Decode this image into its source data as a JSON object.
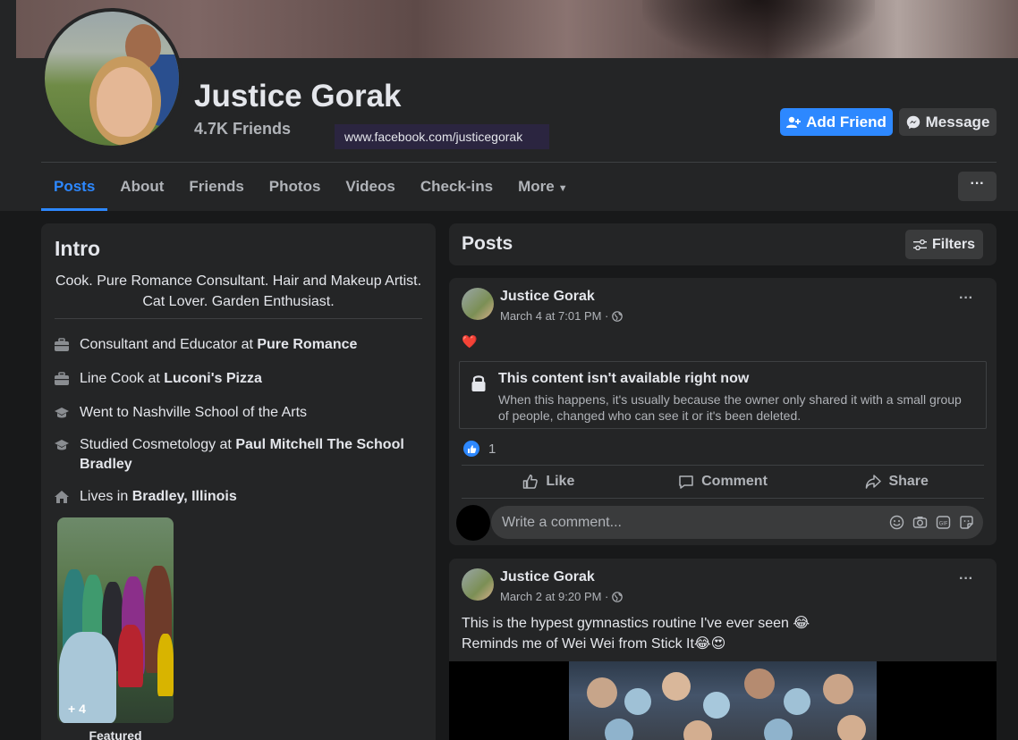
{
  "profile": {
    "name": "Justice Gorak",
    "friends": "4.7K Friends",
    "url": "www.facebook.com/justicegorak",
    "add_friend_label": "Add Friend",
    "message_label": "Message"
  },
  "tabs": [
    {
      "label": "Posts",
      "active": true
    },
    {
      "label": "About"
    },
    {
      "label": "Friends"
    },
    {
      "label": "Photos"
    },
    {
      "label": "Videos"
    },
    {
      "label": "Check-ins"
    },
    {
      "label": "More"
    }
  ],
  "more_menu_label": "···",
  "intro": {
    "title": "Intro",
    "bio": "Cook. Pure Romance Consultant. Hair and Makeup Artist. Cat Lover. Garden Enthusiast.",
    "items": [
      {
        "icon": "briefcase-icon",
        "prefix": "Consultant and Educator at ",
        "bold": "Pure Romance"
      },
      {
        "icon": "briefcase-icon",
        "prefix": "Line Cook at ",
        "bold": "Luconi's Pizza"
      },
      {
        "icon": "graduation-cap-icon",
        "prefix": "Went to Nashville School of the Arts",
        "bold": ""
      },
      {
        "icon": "graduation-cap-icon",
        "prefix": "Studied Cosmetology at ",
        "bold": "Paul Mitchell The School Bradley"
      },
      {
        "icon": "home-icon",
        "prefix": "Lives in ",
        "bold": "Bradley, Illinois"
      }
    ],
    "featured_count": "+ 4",
    "featured_label": "Featured"
  },
  "posts_header": {
    "title": "Posts",
    "filters_label": "Filters"
  },
  "posts": [
    {
      "author": "Justice Gorak",
      "time": "March 4 at 7:01 PM ·",
      "menu": "···",
      "reaction_emoji": "❤️",
      "unavailable_title": "This content isn't available right now",
      "unavailable_body": "When this happens, it's usually because the owner only shared it with a small group of people, changed who can see it or it's been deleted.",
      "like_count": "1",
      "actions": {
        "like": "Like",
        "comment": "Comment",
        "share": "Share"
      },
      "comment_placeholder": "Write a comment..."
    },
    {
      "author": "Justice Gorak",
      "time": "March 2 at 9:20 PM ·",
      "menu": "···",
      "text_line1": "This is the hypest gymnastics routine I've ever seen 😂",
      "text_line2": "Reminds me of Wei Wei from Stick It😂😍"
    }
  ],
  "colors": {
    "accent": "#2d88ff",
    "background": "#18191a",
    "card": "#242526",
    "button": "#3a3b3c"
  }
}
